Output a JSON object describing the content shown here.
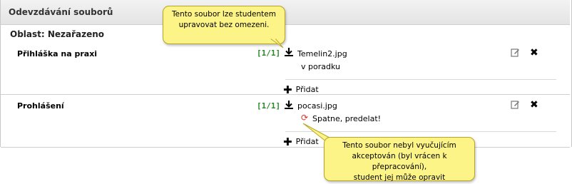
{
  "section": {
    "title": "Odevzdávání souborů"
  },
  "area": {
    "label": "Oblast: Nezařazeno"
  },
  "rows": [
    {
      "name": "Přihláška na praxi",
      "count": "[1/1]",
      "file": "Temelin2.jpg",
      "note": "v poradku",
      "add_label": "Přidat"
    },
    {
      "name": "Prohlášení",
      "count": "[1/1]",
      "file": "pocasi.jpg",
      "note": "Spatne, predelat!",
      "add_label": "Přidat"
    }
  ],
  "tooltips": {
    "top": {
      "line1": "Tento soubor lze studentem",
      "line2": "upravovat bez omezeni."
    },
    "bottom": {
      "line1": "Tento soubor nebyl vyučujícím",
      "line2": "akceptován (byl vrácen k přepracování),",
      "line3": "student jej může opravit"
    }
  },
  "icons": {
    "download": "download-icon",
    "edit": "edit-icon",
    "delete": "delete-icon",
    "add": "plus-icon",
    "returned": "refresh-icon"
  },
  "colors": {
    "count": "#2a8a2a",
    "tooltip_bg": "#fdf487",
    "returned_icon": "#e0312b"
  }
}
